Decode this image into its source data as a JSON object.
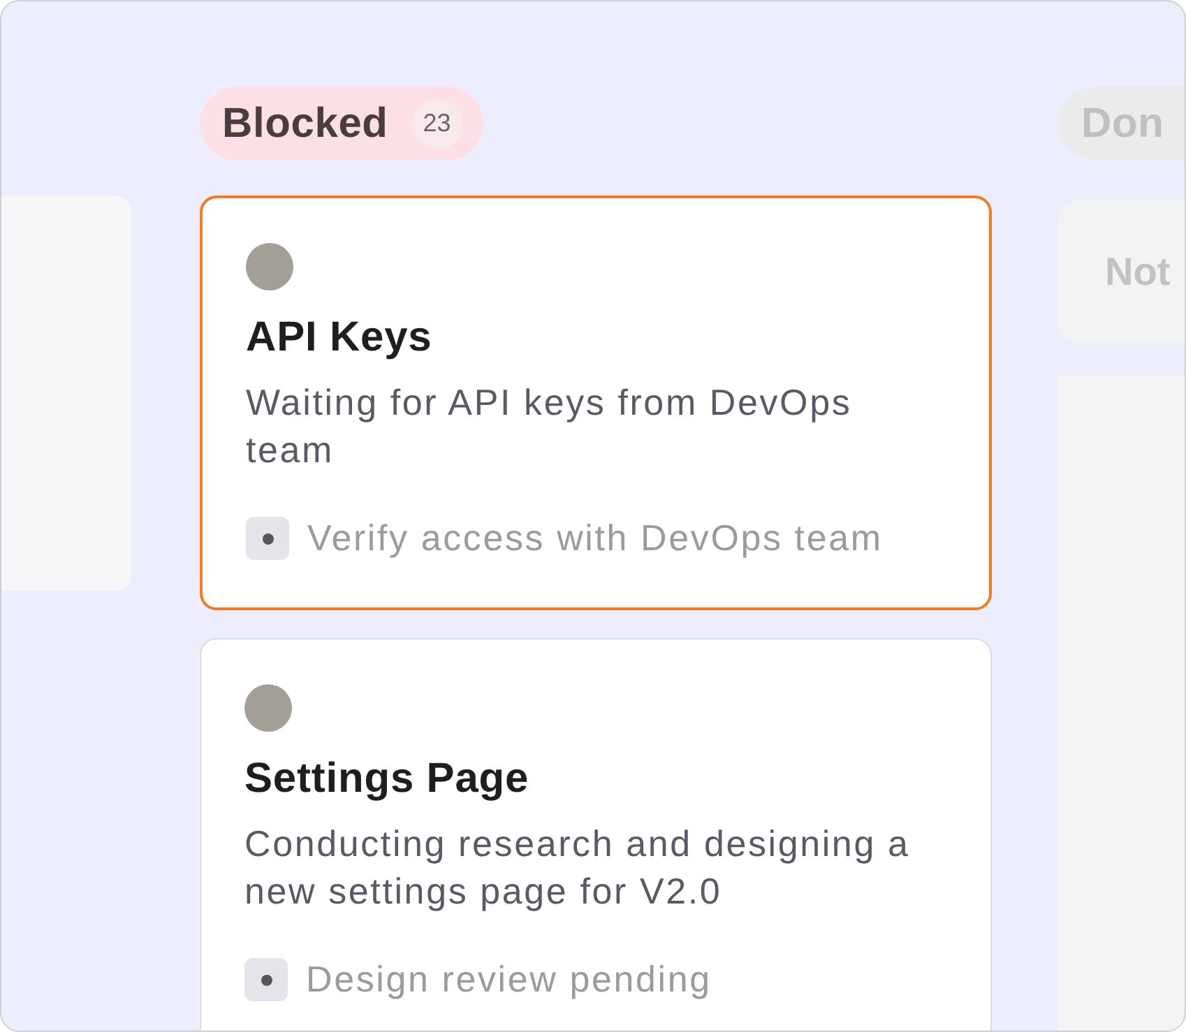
{
  "blocked_column": {
    "label": "Blocked",
    "count": "23",
    "cards": [
      {
        "title": "API Keys",
        "description": "Waiting for API keys from DevOps team",
        "subtask": "Verify access with DevOps team",
        "selected": true
      },
      {
        "title": "Settings Page",
        "description": "Conducting research and designing a new settings page for V2.0",
        "subtask": "Design review pending",
        "selected": false
      }
    ]
  },
  "done_column": {
    "label": "Don",
    "cards": [
      {
        "title": "Not"
      }
    ]
  }
}
